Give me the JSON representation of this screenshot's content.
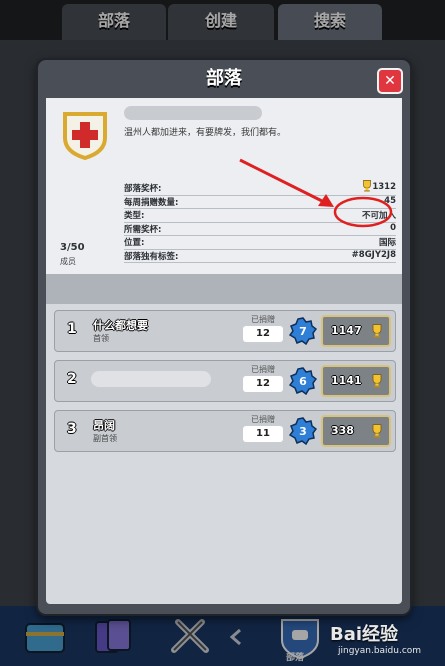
{
  "top_tabs": [
    "部落",
    "创建",
    "搜索"
  ],
  "dialog": {
    "title": "部落",
    "close_label": "✕"
  },
  "clan": {
    "description": "温州人都加进来，有要牌发，我们都有。",
    "members_count": "3/50",
    "members_label": "成员",
    "stats": [
      {
        "label": "部落奖杯:",
        "value": "1312"
      },
      {
        "label": "每周捐赠数量:",
        "value": "45"
      },
      {
        "label": "类型:",
        "value": "不可加入"
      },
      {
        "label": "所需奖杯:",
        "value": "0"
      },
      {
        "label": "位置:",
        "value": "国际"
      },
      {
        "label": "部落独有标签:",
        "value": "#8GJY2J8"
      }
    ]
  },
  "members": [
    {
      "rank": "1",
      "name": "什么都想要",
      "role": "首领",
      "donated_label": "已捐赠",
      "donated": "12",
      "level": "7",
      "trophies": "1147"
    },
    {
      "rank": "2",
      "name": "",
      "role": "",
      "donated_label": "已捐赠",
      "donated": "12",
      "level": "6",
      "trophies": "1141"
    },
    {
      "rank": "3",
      "name": "昂阔",
      "role": "副首领",
      "donated_label": "已捐赠",
      "donated": "11",
      "level": "3",
      "trophies": "338"
    }
  ],
  "bottom_nav": {
    "active_label": "部落"
  },
  "watermark": {
    "brand": "Bai经验",
    "url": "jingyan.baidu.com"
  },
  "colors": {
    "close_red": "#e0363f",
    "level_blue": "#2f7fd6",
    "trophy_gold": "#f2c230",
    "annotation_red": "#e02020"
  }
}
